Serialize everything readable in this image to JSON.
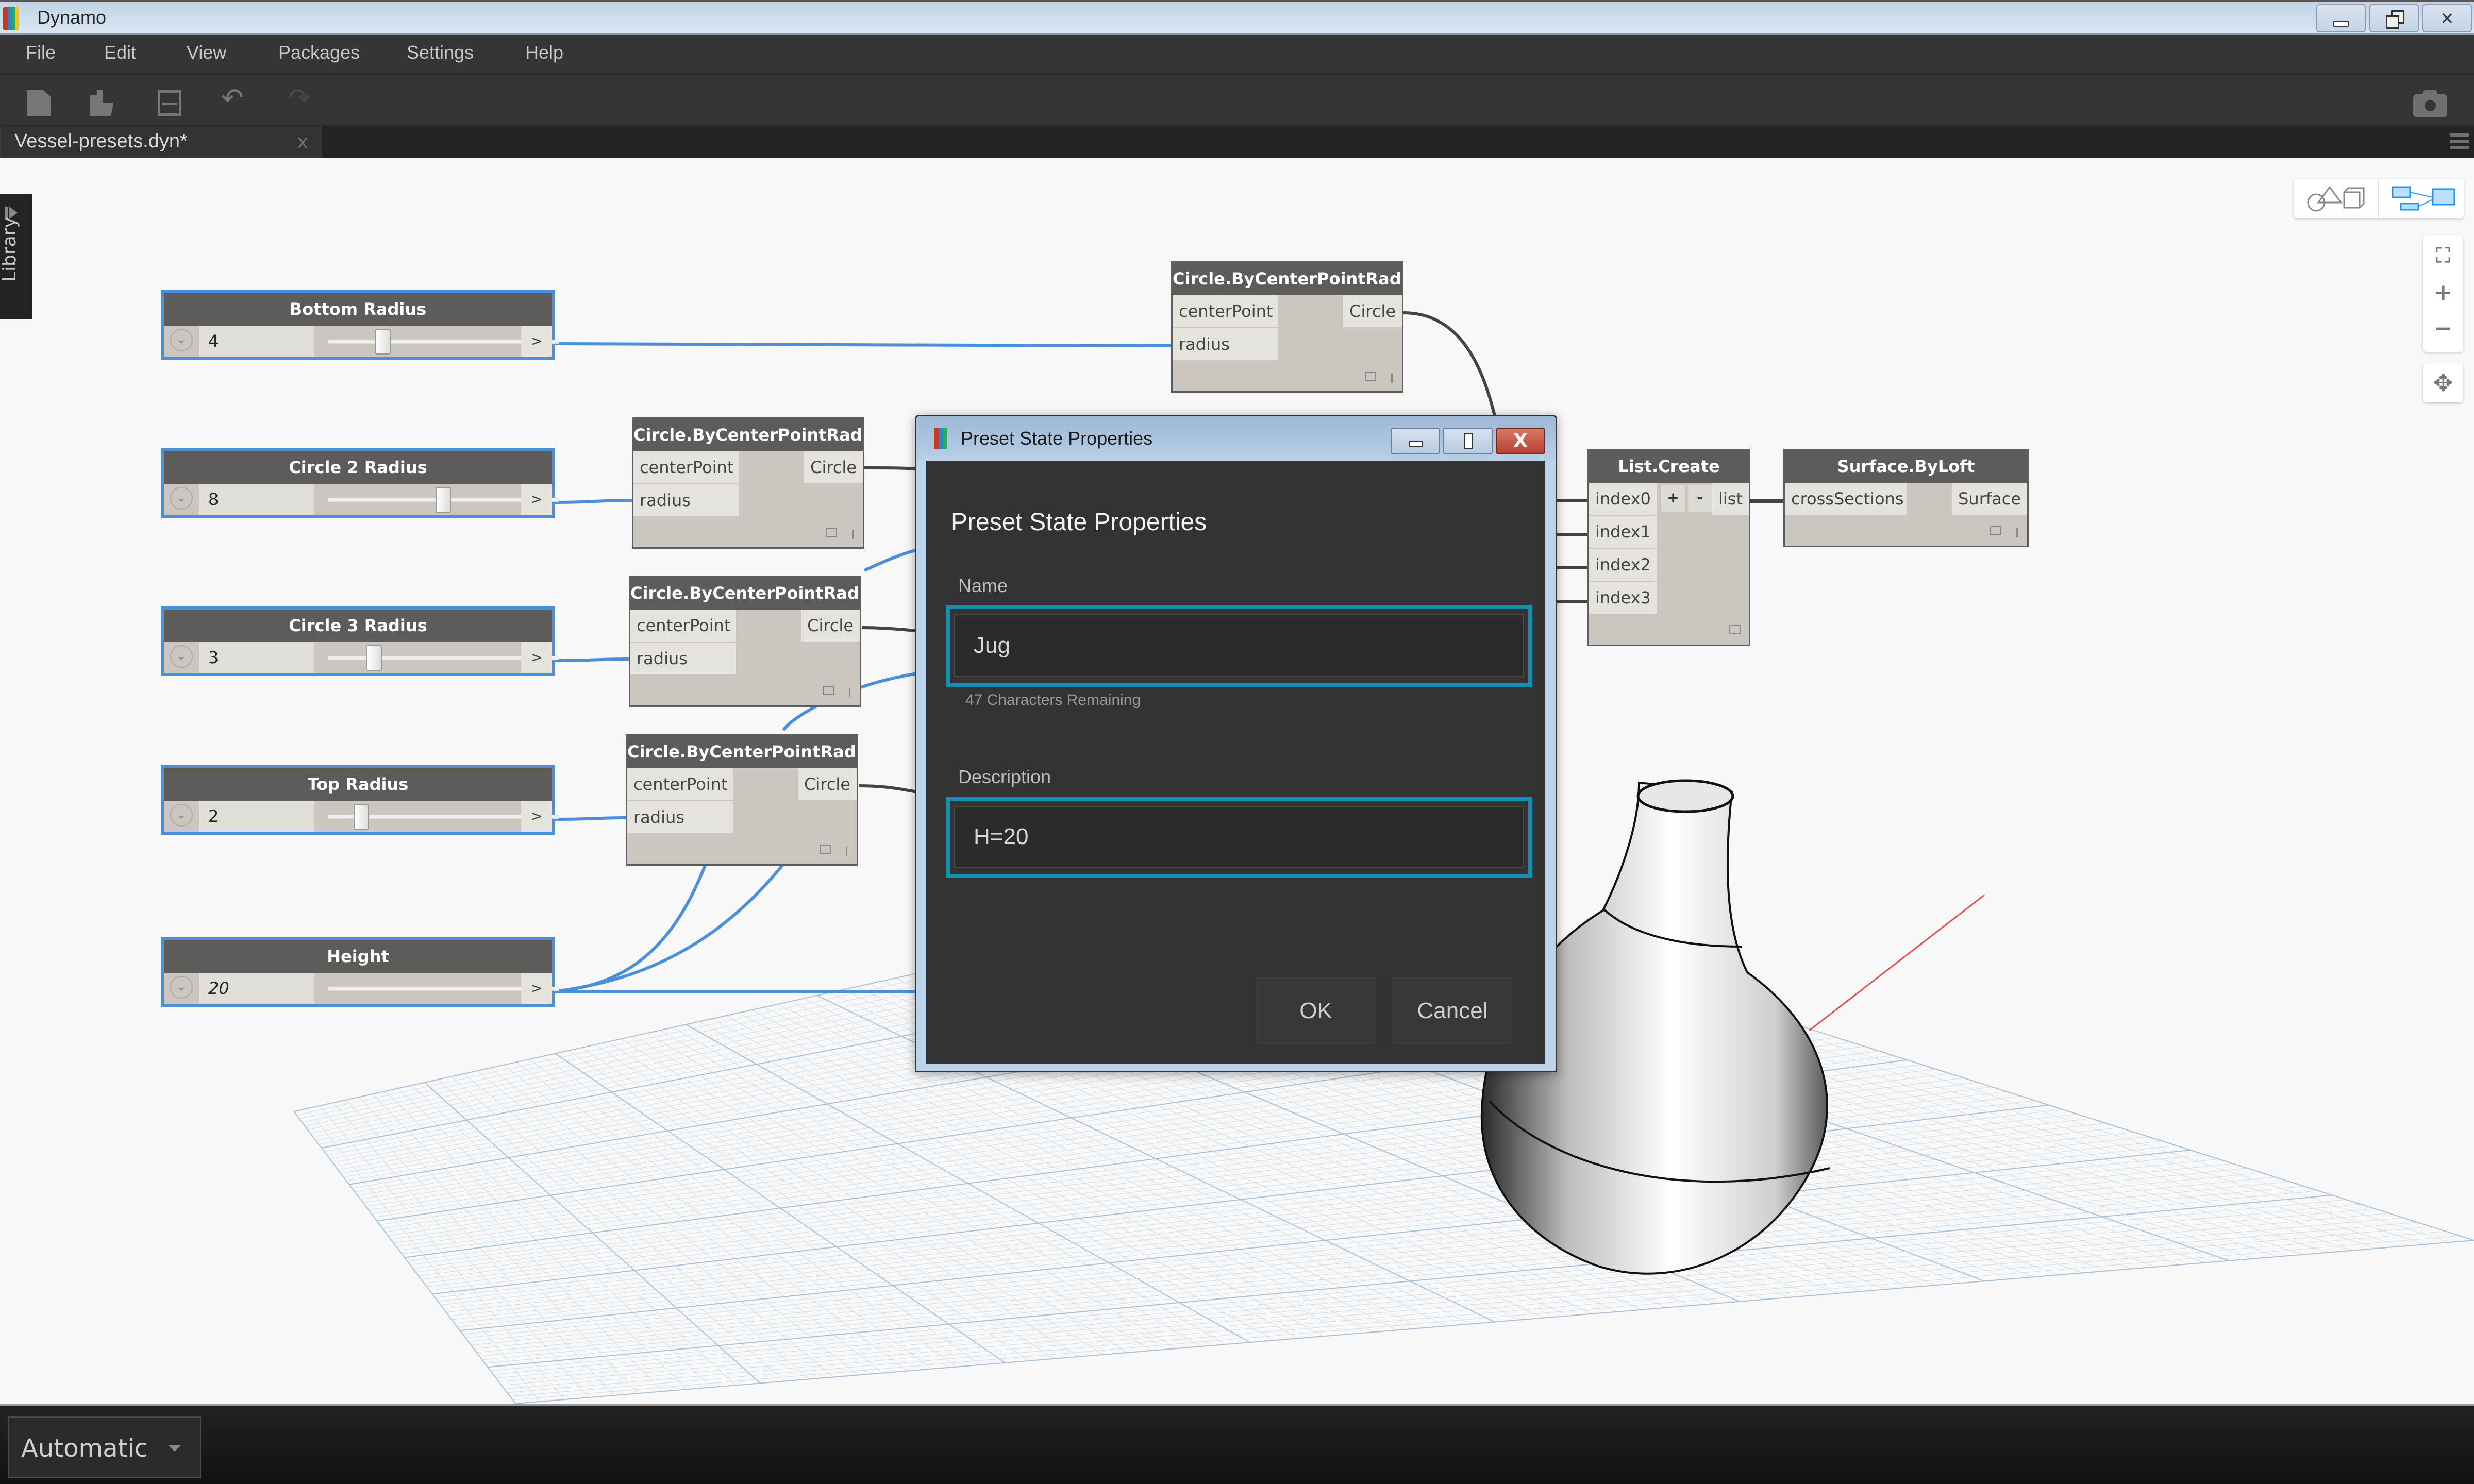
{
  "window": {
    "title": "Dynamo",
    "controls": {
      "minimize": "minimize",
      "restore": "restore",
      "close": "close"
    }
  },
  "menu": [
    "File",
    "Edit",
    "View",
    "Packages",
    "Settings",
    "Help"
  ],
  "toolbar": {
    "icons": [
      "new-file-icon",
      "open-file-icon",
      "save-icon",
      "undo-icon",
      "redo-icon",
      "camera-icon"
    ]
  },
  "tabs": [
    {
      "label": "Vessel-presets.dyn*",
      "close": "x"
    }
  ],
  "library": {
    "label": "Library"
  },
  "view_controls": {
    "geometry_view": "geometry-view-icon",
    "graph_view": "graph-view-icon",
    "zoom_fit": "zoom-fit-icon",
    "zoom_in": "+",
    "zoom_out": "−",
    "pan": "✥"
  },
  "sliders": [
    {
      "title": "Bottom Radius",
      "value": "4",
      "fraction": 0.22,
      "italic": false
    },
    {
      "title": "Circle 2 Radius",
      "value": "8",
      "fraction": 0.5,
      "italic": false
    },
    {
      "title": "Circle 3 Radius",
      "value": "3",
      "fraction": 0.18,
      "italic": false
    },
    {
      "title": "Top Radius",
      "value": "2",
      "fraction": 0.12,
      "italic": false
    },
    {
      "title": "Height",
      "value": "20",
      "fraction": 0.97,
      "italic": true
    }
  ],
  "circle_nodes": [
    {
      "title": "Circle.ByCenterPointRadius",
      "inputs": [
        "centerPoint",
        "radius"
      ],
      "output": "Circle"
    },
    {
      "title": "Circle.ByCenterPointRadius",
      "inputs": [
        "centerPoint",
        "radius"
      ],
      "output": "Circle"
    },
    {
      "title": "Circle.ByCenterPointRadius",
      "inputs": [
        "centerPoint",
        "radius"
      ],
      "output": "Circle"
    },
    {
      "title": "Circle.ByCenterPointRadius",
      "inputs": [
        "centerPoint",
        "radius"
      ],
      "output": "Circle"
    }
  ],
  "list_create": {
    "title": "List.Create",
    "inputs": [
      "index0",
      "index1",
      "index2",
      "index3"
    ],
    "add": "+",
    "remove": "-",
    "output": "list"
  },
  "surface_loft": {
    "title": "Surface.ByLoft",
    "input": "crossSections",
    "output": "Surface"
  },
  "dialog": {
    "window_title": "Preset State Properties",
    "heading": "Preset State Properties",
    "name_label": "Name",
    "name_value": "Jug",
    "chars_remaining": "47 Characters Remaining",
    "description_label": "Description",
    "description_value": "H=20",
    "ok": "OK",
    "cancel": "Cancel",
    "close_glyph": "X",
    "accent": "#1190b5"
  },
  "run_mode": {
    "selected": "Automatic"
  },
  "colors": {
    "wire_selected": "#4a90d9",
    "wire_default": "#444444",
    "node_header": "#5e5b59",
    "dialog_accent": "#1190b5"
  }
}
